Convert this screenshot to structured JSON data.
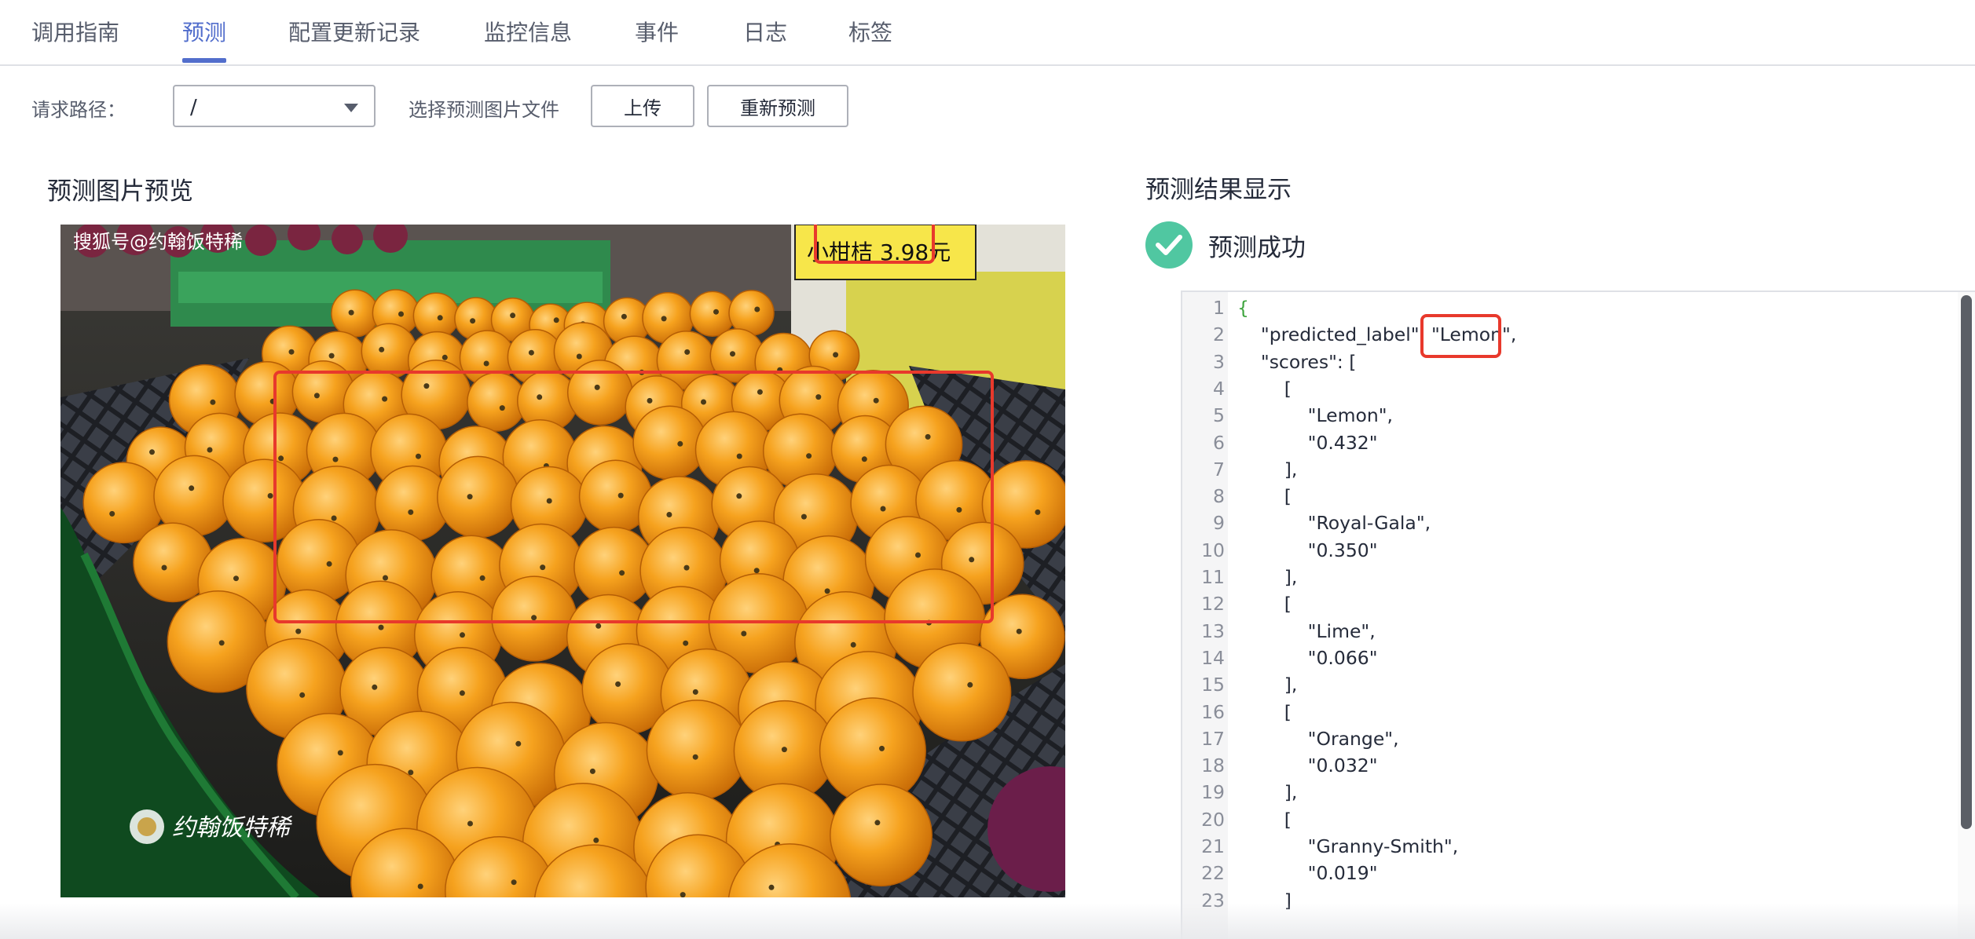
{
  "tabs": [
    {
      "label": "调用指南"
    },
    {
      "label": "预测"
    },
    {
      "label": "配置更新记录"
    },
    {
      "label": "监控信息"
    },
    {
      "label": "事件"
    },
    {
      "label": "日志"
    },
    {
      "label": "标签"
    }
  ],
  "active_tab": "预测",
  "toolbar": {
    "path_label": "请求路径：",
    "path_value": "/",
    "file_label": "选择预测图片文件",
    "upload_button": "上传",
    "repredict_button": "重新预测"
  },
  "preview": {
    "title": "预测图片预览",
    "watermark_top": "搜狐号@约翰饭特稀",
    "watermark_bottom": "约翰饭特稀",
    "price_tag_text": "小柑桔 3.98元"
  },
  "result": {
    "title": "预测结果显示",
    "status": "预测成功",
    "status_color": "#50c7a1",
    "code_lines": [
      "{",
      "    \"predicted_label\": \"Lemon\",",
      "    \"scores\": [",
      "        [",
      "            \"Lemon\",",
      "            \"0.432\"",
      "        ],",
      "        [",
      "            \"Royal-Gala\",",
      "            \"0.350\"",
      "        ],",
      "        [",
      "            \"Lime\",",
      "            \"0.066\"",
      "        ],",
      "        [",
      "            \"Orange\",",
      "            \"0.032\"",
      "        ],",
      "        [",
      "            \"Granny-Smith\",",
      "            \"0.019\"",
      "        ]"
    ]
  },
  "colors": {
    "accent": "#526ecc",
    "highlight": "#e8392c",
    "orange": "#f29a1a"
  }
}
